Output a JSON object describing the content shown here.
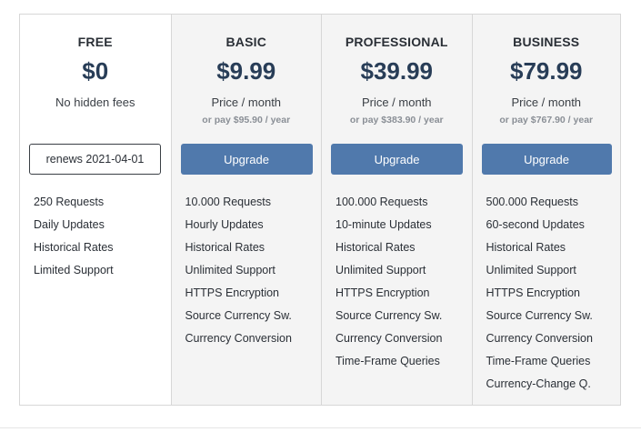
{
  "plans": [
    {
      "name": "FREE",
      "price": "$0",
      "subtitle": "No hidden fees",
      "yearly": "",
      "renew_text": "renews 2021-04-01",
      "features": [
        "250 Requests",
        "Daily Updates",
        "Historical Rates",
        "Limited Support"
      ]
    },
    {
      "name": "BASIC",
      "price": "$9.99",
      "subtitle": "Price / month",
      "yearly": "or pay $95.90 / year",
      "button_label": "Upgrade",
      "features": [
        "10.000 Requests",
        "Hourly Updates",
        "Historical Rates",
        "Unlimited Support",
        "HTTPS Encryption",
        "Source Currency Sw.",
        "Currency Conversion"
      ]
    },
    {
      "name": "PROFESSIONAL",
      "price": "$39.99",
      "subtitle": "Price / month",
      "yearly": "or pay $383.90 / year",
      "button_label": "Upgrade",
      "features": [
        "100.000 Requests",
        "10-minute Updates",
        "Historical Rates",
        "Unlimited Support",
        "HTTPS Encryption",
        "Source Currency Sw.",
        "Currency Conversion",
        "Time-Frame Queries"
      ]
    },
    {
      "name": "BUSINESS",
      "price": "$79.99",
      "subtitle": "Price / month",
      "yearly": "or pay $767.90 / year",
      "button_label": "Upgrade",
      "features": [
        "500.000 Requests",
        "60-second Updates",
        "Historical Rates",
        "Unlimited Support",
        "HTTPS Encryption",
        "Source Currency Sw.",
        "Currency Conversion",
        "Time-Frame Queries",
        "Currency-Change Q."
      ]
    }
  ],
  "colors": {
    "button": "#5079ac",
    "price": "#283d57",
    "paid_bg": "#f4f4f4",
    "border": "#d7d7d7"
  }
}
